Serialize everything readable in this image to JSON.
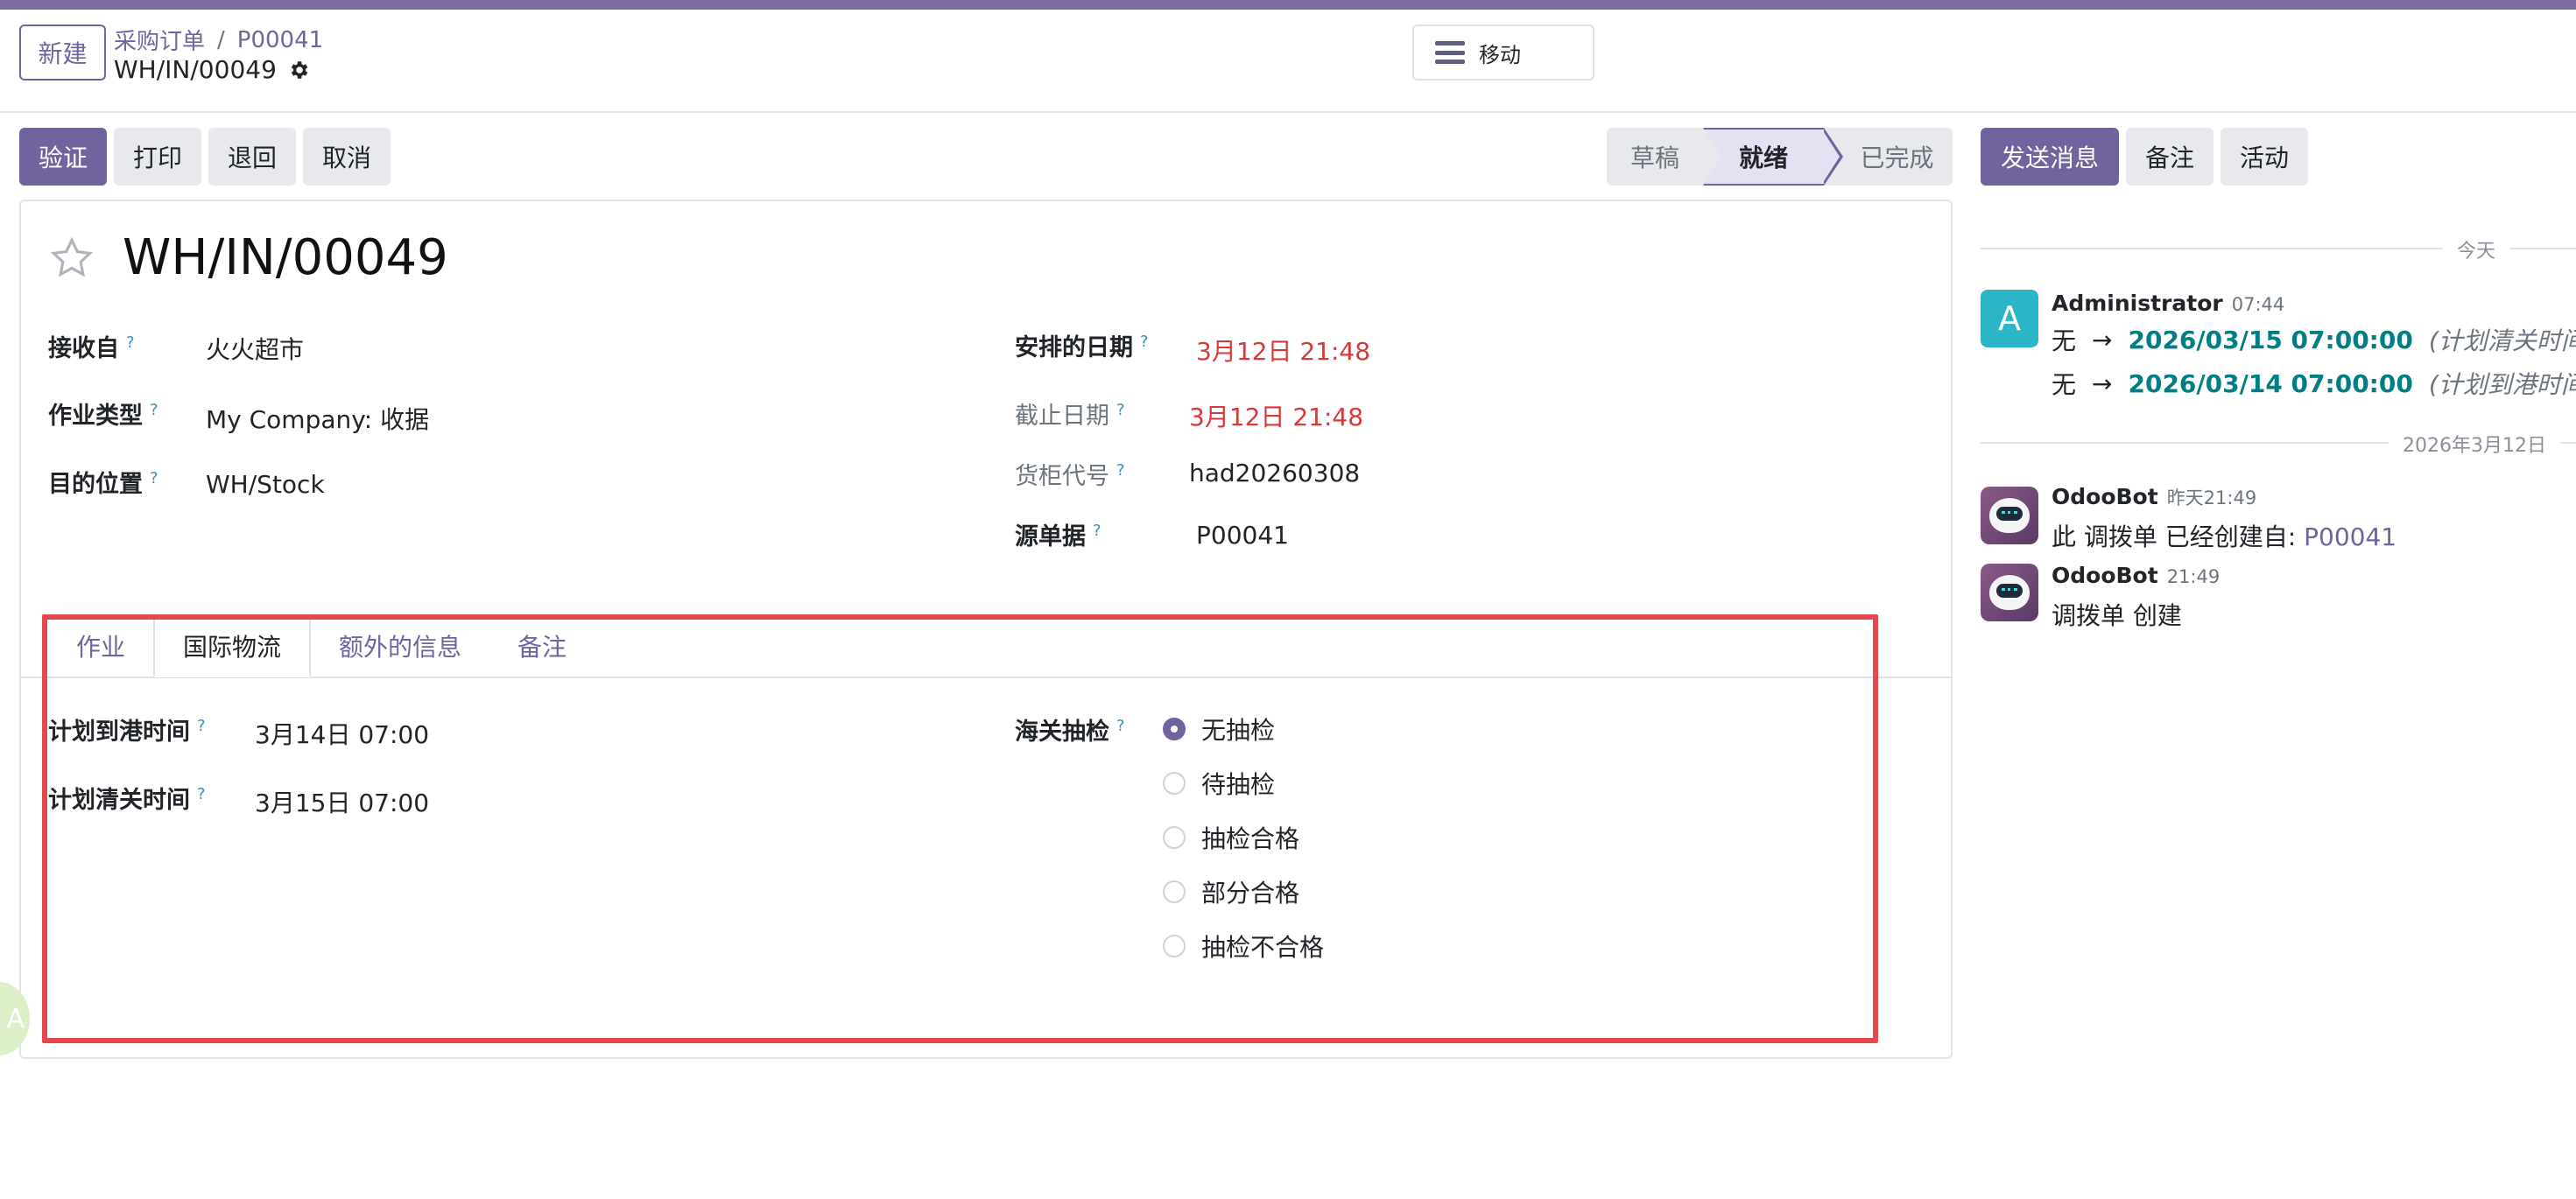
{
  "header": {
    "new_button": "新建",
    "breadcrumb": {
      "parent": "采购订单",
      "separator": "/",
      "order": "P00041"
    },
    "record_name": "WH/IN/00049",
    "move_button": "移动"
  },
  "actions": {
    "validate": "验证",
    "print": "打印",
    "return": "退回",
    "cancel": "取消"
  },
  "status": {
    "draft": "草稿",
    "ready": "就绪",
    "done": "已完成",
    "current": "ready"
  },
  "form": {
    "title": "WH/IN/00049",
    "left_fields": [
      {
        "label": "接收自",
        "help": "?",
        "value": "火火超市"
      },
      {
        "label": "作业类型",
        "help": "?",
        "value": "My Company: 收据"
      },
      {
        "label": "目的位置",
        "help": "?",
        "value": "WH/Stock"
      }
    ],
    "right_fields": [
      {
        "label": "安排的日期",
        "help": "?",
        "value": "3月12日 21:48"
      },
      {
        "label": "截止日期",
        "help": "?",
        "value": "3月12日 21:48"
      },
      {
        "label": "货柜代号",
        "help": "?",
        "value": "had20260308"
      },
      {
        "label": "源单据",
        "help": "?",
        "value": "P00041"
      }
    ]
  },
  "tabs": [
    {
      "label": "作业"
    },
    {
      "label": "国际物流"
    },
    {
      "label": "额外的信息"
    },
    {
      "label": "备注"
    }
  ],
  "logistics": {
    "planned_arrival_label": "计划到港时间",
    "planned_arrival_help": "?",
    "planned_arrival_value": "3月14日 07:00",
    "planned_clearance_label": "计划清关时间",
    "planned_clearance_help": "?",
    "planned_clearance_value": "3月15日 07:00",
    "inspection_label": "海关抽检",
    "inspection_help": "?",
    "inspection_options": [
      "无抽检",
      "待抽检",
      "抽检合格",
      "部分合格",
      "抽检不合格"
    ],
    "inspection_selected": "无抽检"
  },
  "chatter": {
    "send_message": "发送消息",
    "log_note": "备注",
    "activities": "活动",
    "divider_today": "今天",
    "divider_date": "2026年3月12日",
    "messages": [
      {
        "avatar_letter": "A",
        "author": "Administrator",
        "time": "07:44",
        "tracking": [
          {
            "old": "无",
            "arrow": "→",
            "new": "2026/03/15 07:00:00",
            "field": "(计划清关时间)"
          },
          {
            "old": "无",
            "arrow": "→",
            "new": "2026/03/14 07:00:00",
            "field": "(计划到港时间)"
          }
        ]
      },
      {
        "author": "OdooBot",
        "time": "昨天21:49",
        "text": "此 调拨单 已经创建自:",
        "link": "P00041"
      },
      {
        "author": "OdooBot",
        "time": "21:49",
        "text": "调拨单 创建"
      }
    ]
  },
  "colors": {
    "brand": "#71639e",
    "danger_date": "#d33a3a",
    "tracking_value": "#017e84",
    "highlight_box": "#e5484d",
    "avatar_admin": "#2bb5c7"
  },
  "icons": [
    "gear-icon",
    "hamburger-icon",
    "star-icon",
    "radio-icon",
    "odoobot-avatar-icon"
  ]
}
